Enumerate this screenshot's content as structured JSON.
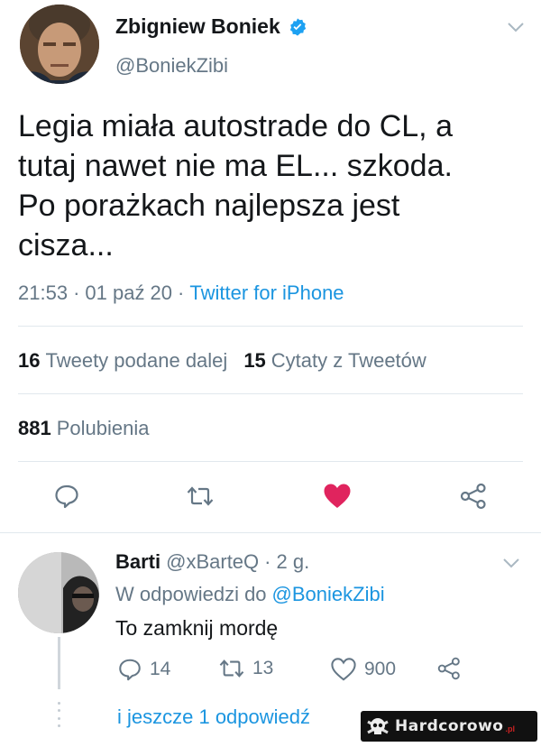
{
  "tweet": {
    "author_name": "Zbigniew Boniek",
    "author_handle": "@BoniekZibi",
    "text": "Legia miała autostrade do CL, a\ntutaj nawet nie ma EL... szkoda.\nPo porażkach najlepsza jest\ncisza...",
    "time": "21:53",
    "date": "01 paź 20",
    "source": "Twitter for iPhone",
    "sep": "·"
  },
  "stats": {
    "retweets_count": "16",
    "retweets_label": "Tweety podane dalej",
    "quotes_count": "15",
    "quotes_label": "Cytaty z Tweetów",
    "likes_count": "881",
    "likes_label": "Polubienia"
  },
  "actions": [
    "reply-icon",
    "retweet-icon",
    "like-icon-filled",
    "share-icon"
  ],
  "reply": {
    "name": "Barti",
    "handle": "@xBarteQ",
    "sep": "·",
    "age": "2 g.",
    "in_reply_prefix": "W odpowiedzi do",
    "in_reply_mention": "@BoniekZibi",
    "text": "To zamknij mordę",
    "reply_count": "14",
    "retweet_count": "13",
    "like_count": "900"
  },
  "more_replies": "i jeszcze 1 odpowiedź",
  "watermark": {
    "text": "Hardcorowo",
    "tld": ".pl"
  },
  "colors": {
    "text": "#14171a",
    "muted": "#657786",
    "link": "#1b95e0",
    "like": "#e0245e",
    "divider": "#e1e8ed"
  }
}
